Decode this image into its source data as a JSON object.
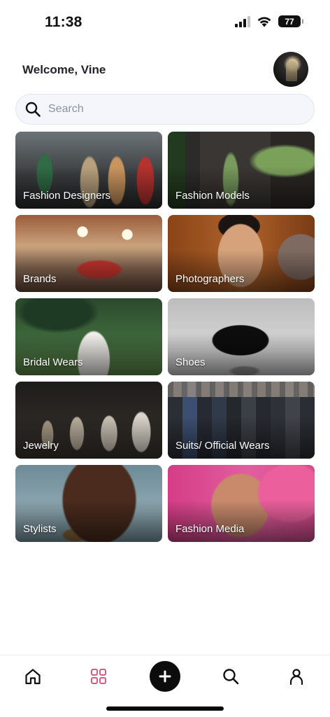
{
  "status_bar": {
    "time": "11:38",
    "battery": "77",
    "signal_bars": 4,
    "signal_active_bars": 3
  },
  "header": {
    "welcome_text": "Welcome, Vine",
    "avatar_icon": "profile-photo"
  },
  "search": {
    "placeholder": "Search",
    "value": "",
    "icon": "search-icon"
  },
  "categories": [
    {
      "label": "Fashion Designers"
    },
    {
      "label": "Fashion Models"
    },
    {
      "label": "Brands"
    },
    {
      "label": "Photographers"
    },
    {
      "label": "Bridal Wears"
    },
    {
      "label": "Shoes"
    },
    {
      "label": "Jewelry"
    },
    {
      "label": "Suits/ Official Wears"
    },
    {
      "label": "Stylists"
    },
    {
      "label": "Fashion Media"
    }
  ],
  "bottom_nav": {
    "items": [
      {
        "icon": "home-icon",
        "active": false
      },
      {
        "icon": "grid-icon",
        "active": true
      },
      {
        "icon": "plus-icon",
        "active": false
      },
      {
        "icon": "search-icon",
        "active": false
      },
      {
        "icon": "profile-icon",
        "active": false
      }
    ],
    "active_color": "#e0567f",
    "inactive_color": "#111111"
  }
}
